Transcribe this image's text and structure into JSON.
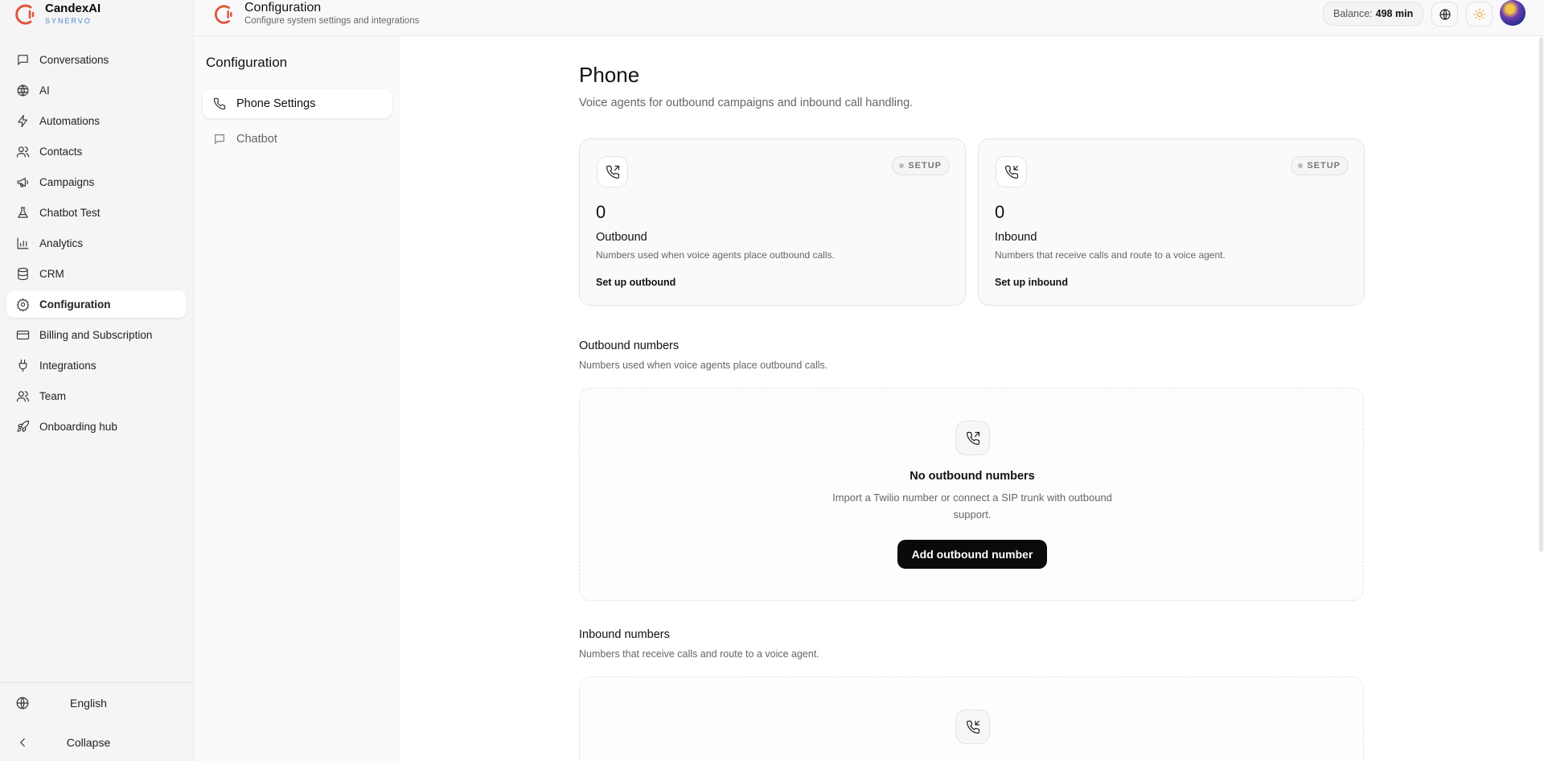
{
  "brand": {
    "name": "CandexAI",
    "subtitle": "SYNERVO",
    "accent": "#e2533d"
  },
  "sidebar": {
    "items": [
      {
        "label": "Conversations",
        "icon": "message-square-icon"
      },
      {
        "label": "AI",
        "icon": "globe-brain-icon"
      },
      {
        "label": "Automations",
        "icon": "zap-icon"
      },
      {
        "label": "Contacts",
        "icon": "users-icon"
      },
      {
        "label": "Campaigns",
        "icon": "megaphone-icon"
      },
      {
        "label": "Chatbot Test",
        "icon": "flask-icon"
      },
      {
        "label": "Analytics",
        "icon": "bar-chart-icon"
      },
      {
        "label": "CRM",
        "icon": "database-icon"
      },
      {
        "label": "Configuration",
        "icon": "gear-icon",
        "active": true
      },
      {
        "label": "Billing and Subscription",
        "icon": "credit-card-icon"
      },
      {
        "label": "Integrations",
        "icon": "plug-icon"
      },
      {
        "label": "Team",
        "icon": "users-icon"
      },
      {
        "label": "Onboarding hub",
        "icon": "rocket-icon"
      }
    ],
    "language": "English",
    "collapse": "Collapse"
  },
  "header": {
    "title": "Configuration",
    "subtitle": "Configure system settings and integrations",
    "balance_label": "Balance:",
    "balance_value": "498 min"
  },
  "subnav": {
    "title": "Configuration",
    "items": [
      {
        "label": "Phone Settings",
        "icon": "phone-icon",
        "active": true
      },
      {
        "label": "Chatbot",
        "icon": "message-square-icon",
        "active": false
      }
    ]
  },
  "main": {
    "title": "Phone",
    "subtitle": "Voice agents for outbound campaigns and inbound call handling.",
    "cards": [
      {
        "count": "0",
        "label": "Outbound",
        "desc": "Numbers used when voice agents place outbound calls.",
        "link": "Set up outbound",
        "badge": "SETUP",
        "icon": "phone-outgoing-icon"
      },
      {
        "count": "0",
        "label": "Inbound",
        "desc": "Numbers that receive calls and route to a voice agent.",
        "link": "Set up inbound",
        "badge": "SETUP",
        "icon": "phone-incoming-icon"
      }
    ],
    "outbound_section": {
      "title": "Outbound numbers",
      "subtitle": "Numbers used when voice agents place outbound calls.",
      "empty_title": "No outbound numbers",
      "empty_desc": "Import a Twilio number or connect a SIP trunk with outbound support.",
      "button": "Add outbound number"
    },
    "inbound_section": {
      "title": "Inbound numbers",
      "subtitle": "Numbers that receive calls and route to a voice agent."
    }
  }
}
